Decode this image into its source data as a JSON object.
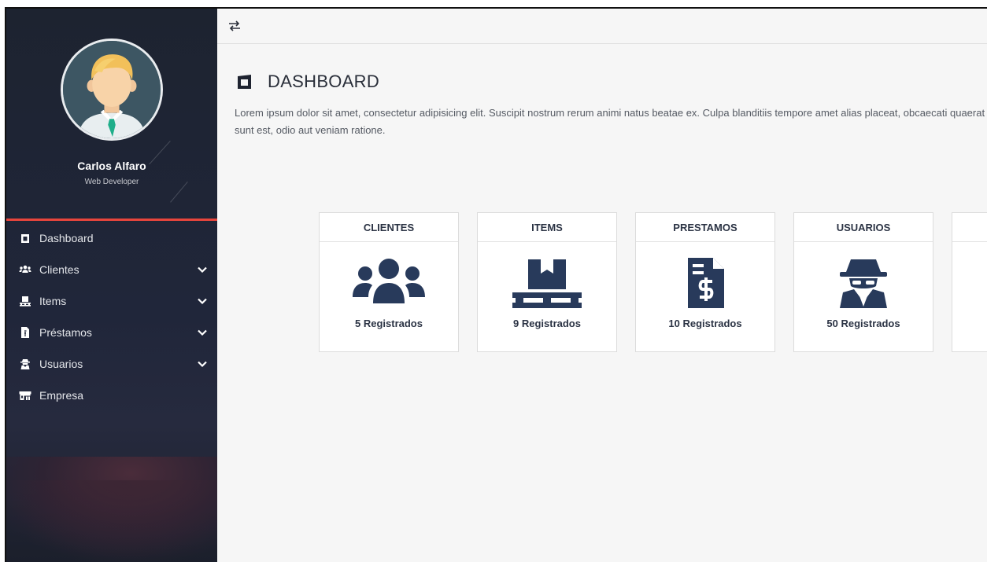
{
  "sidebar": {
    "user": {
      "name": "Carlos Alfaro",
      "role": "Web Developer"
    },
    "items": [
      {
        "label": "Dashboard",
        "icon": "dashboard-icon",
        "expandable": false
      },
      {
        "label": "Clientes",
        "icon": "users-icon",
        "expandable": true
      },
      {
        "label": "Items",
        "icon": "pallet-icon",
        "expandable": true
      },
      {
        "label": "Préstamos",
        "icon": "invoice-dollar-icon",
        "expandable": true
      },
      {
        "label": "Usuarios",
        "icon": "user-secret-icon",
        "expandable": true
      },
      {
        "label": "Empresa",
        "icon": "store-icon",
        "expandable": false
      }
    ]
  },
  "topbar": {
    "toggle_icon": "exchange-arrows-icon"
  },
  "main": {
    "title": "DASHBOARD",
    "description": "Lorem ipsum dolor sit amet, consectetur adipisicing elit. Suscipit nostrum rerum animi natus beatae ex. Culpa blanditiis tempore amet alias placeat, obcaecati quaerat ullam, sunt est, odio aut veniam ratione.",
    "tiles": [
      {
        "title": "CLIENTES",
        "count": "5 Registrados",
        "icon": "users-icon"
      },
      {
        "title": "ITEMS",
        "count": "9 Registrados",
        "icon": "pallet-icon"
      },
      {
        "title": "PRESTAMOS",
        "count": "10 Registrados",
        "icon": "invoice-dollar-icon"
      },
      {
        "title": "USUARIOS",
        "count": "50 Registrados",
        "icon": "user-secret-icon"
      }
    ]
  },
  "colors": {
    "sidebar_bg": "#1d2330",
    "accent_red": "#e8453c",
    "tile_icon": "#283a5b",
    "text_dark": "#2b3344"
  }
}
